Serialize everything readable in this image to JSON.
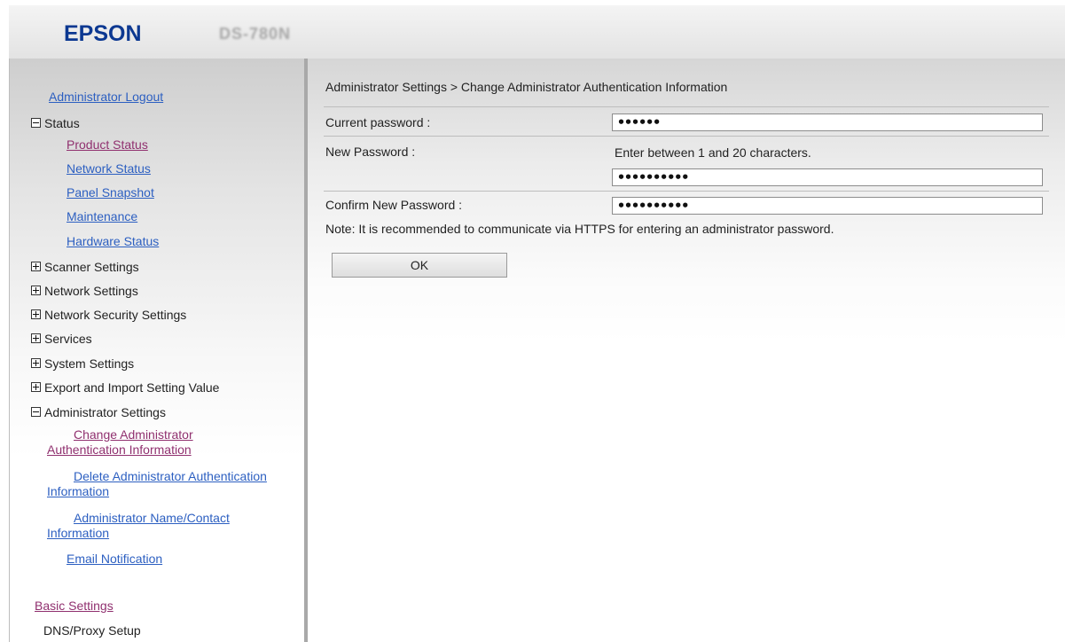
{
  "header": {
    "brand": "EPSON",
    "model": "DS-780N"
  },
  "sidebar": {
    "logout": "Administrator Logout",
    "status": {
      "label": "Status",
      "children": [
        "Product Status",
        "Network Status",
        "Panel Snapshot",
        "Maintenance",
        "Hardware Status"
      ]
    },
    "sections": [
      "Scanner Settings",
      "Network Settings",
      "Network Security Settings",
      "Services",
      "System Settings",
      "Export and Import Setting Value"
    ],
    "admin": {
      "label": "Administrator Settings",
      "change_auth": "Change Administrator Authentication Information",
      "delete_auth": "Delete Administrator Authentication Information",
      "name_contact": "Administrator Name/Contact Information",
      "email_notification": "Email Notification"
    },
    "basic_settings": "Basic Settings",
    "dns_proxy": "DNS/Proxy Setup"
  },
  "main": {
    "breadcrumb": "Administrator Settings > Change Administrator Authentication Information",
    "current_password_label": "Current password :",
    "current_password_value": "••••••",
    "new_password_label": "New Password :",
    "new_password_hint": "Enter between 1 and 20 characters.",
    "new_password_value": "••••••••••",
    "confirm_password_label": "Confirm New Password :",
    "confirm_password_value": "••••••••••",
    "note": "Note: It is recommended to communicate via HTTPS for entering an administrator password.",
    "ok_label": "OK"
  }
}
